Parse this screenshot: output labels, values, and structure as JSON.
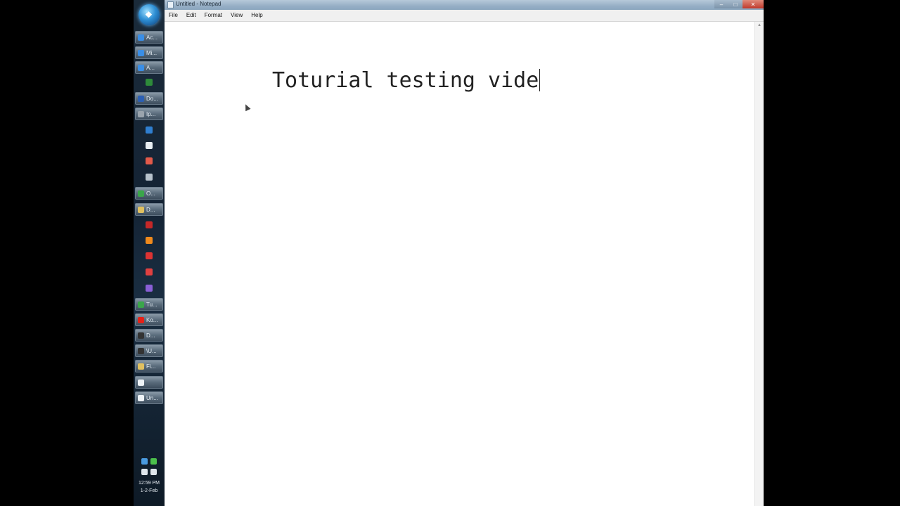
{
  "window": {
    "title": "Untitled - Notepad",
    "controls": {
      "minimize": "–",
      "maximize": "□",
      "close": "✕"
    }
  },
  "menu": [
    "File",
    "Edit",
    "Format",
    "View",
    "Help"
  ],
  "editor": {
    "text": "Toturial testing vide"
  },
  "scrollbar": {
    "up_arrow": "▴"
  },
  "taskbar": {
    "start_glyph": "❖",
    "items": [
      {
        "label": "Ac...",
        "icon": "ie-icon",
        "color": "#3a8ee6",
        "type": "button"
      },
      {
        "label": "Mi...",
        "icon": "ie-icon",
        "color": "#3a8ee6",
        "type": "button"
      },
      {
        "label": "A...",
        "icon": "ie-icon",
        "color": "#3a8ee6",
        "type": "button"
      },
      {
        "label": "",
        "icon": "excel-icon",
        "color": "#2e8b3a",
        "type": "pin"
      },
      {
        "label": "Do...",
        "icon": "word-icon",
        "color": "#2b5fb3",
        "type": "button"
      },
      {
        "label": "Ip...",
        "icon": "settings-icon",
        "color": "#9aa4ad",
        "type": "button"
      },
      {
        "label": "",
        "icon": "outlook-icon",
        "color": "#2f7fd1",
        "type": "pin"
      },
      {
        "label": "",
        "icon": "phone-icon",
        "color": "#e8eef2",
        "type": "pin"
      },
      {
        "label": "",
        "icon": "paint-icon",
        "color": "#e35a4a",
        "type": "pin"
      },
      {
        "label": "",
        "icon": "printer-icon",
        "color": "#b7c2cc",
        "type": "pin"
      },
      {
        "label": "O...",
        "icon": "chrome-icon",
        "color": "#3aa64a",
        "type": "button"
      },
      {
        "label": "D...",
        "icon": "folder-icon",
        "color": "#e0c060",
        "type": "button"
      },
      {
        "label": "",
        "icon": "pdf-icon",
        "color": "#c62828",
        "type": "pin"
      },
      {
        "label": "",
        "icon": "rss-icon",
        "color": "#f08a1c",
        "type": "pin"
      },
      {
        "label": "",
        "icon": "media-icon",
        "color": "#d33",
        "type": "pin"
      },
      {
        "label": "",
        "icon": "record-icon",
        "color": "#e04040",
        "type": "pin"
      },
      {
        "label": "",
        "icon": "globe-icon",
        "color": "#8a5fd6",
        "type": "pin"
      },
      {
        "label": "Tu...",
        "icon": "chrome-icon",
        "color": "#3aa64a",
        "type": "button"
      },
      {
        "label": "Ko...",
        "icon": "youtube-icon",
        "color": "#e62117",
        "type": "button"
      },
      {
        "label": "D...",
        "icon": "terminal-icon",
        "color": "#333",
        "type": "button"
      },
      {
        "label": "\\U...",
        "icon": "terminal-icon",
        "color": "#333",
        "type": "button"
      },
      {
        "label": "Fi...",
        "icon": "folder-icon",
        "color": "#e0c060",
        "type": "button"
      },
      {
        "label": "",
        "icon": "notepad-icon",
        "color": "#eef3f7",
        "type": "button"
      },
      {
        "label": "Un...",
        "icon": "notepad-icon",
        "color": "#eef3f7",
        "type": "button"
      }
    ]
  },
  "tray": {
    "time": "12:59 PM",
    "date": "1-2-Feb",
    "icons": [
      {
        "icon": "network-icon",
        "color": "#4a9be0"
      },
      {
        "icon": "security-icon",
        "color": "#4cc04c"
      },
      {
        "icon": "update-icon",
        "color": "#dfe6ec"
      },
      {
        "icon": "volume-icon",
        "color": "#dfe6ec"
      }
    ]
  }
}
